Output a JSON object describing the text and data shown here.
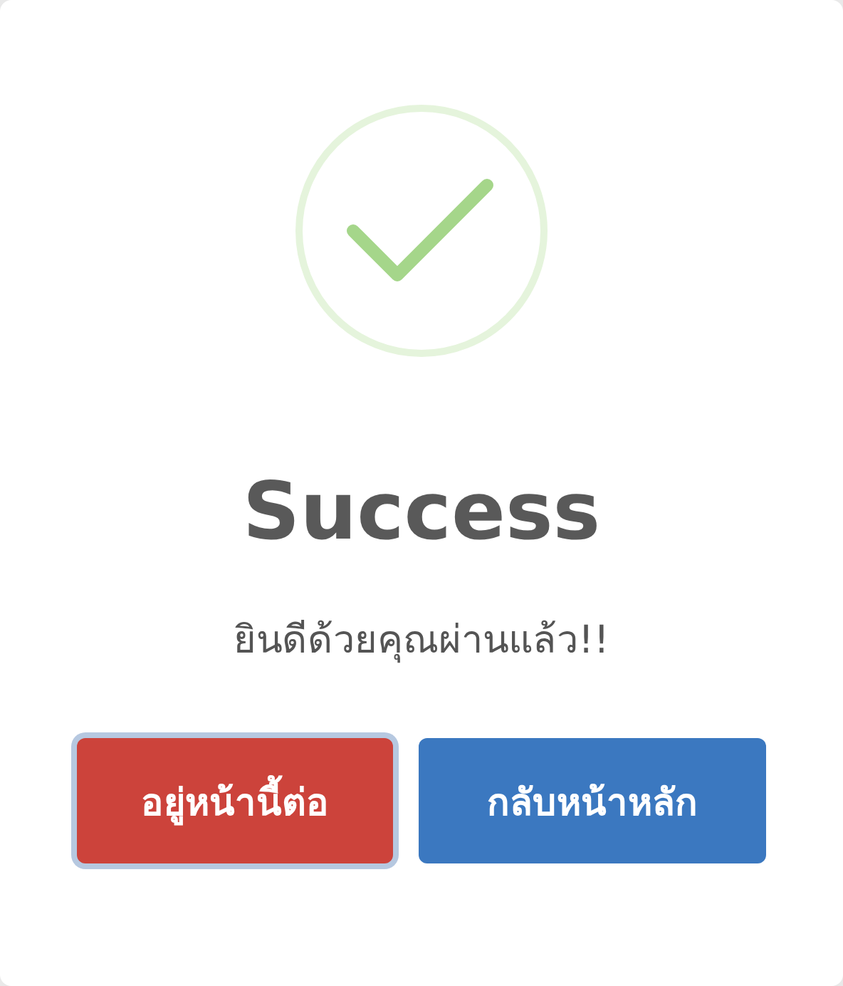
{
  "icon": {
    "kind": "success"
  },
  "title": "Success",
  "message": "ยินดีด้วยคุณผ่านแล้ว!!",
  "buttons": [
    {
      "label": "อยู่หน้านี้ต่อ",
      "kind": "cancel",
      "focused": true
    },
    {
      "label": "กลับหน้าหลัก",
      "kind": "confirm",
      "focused": false
    }
  ]
}
